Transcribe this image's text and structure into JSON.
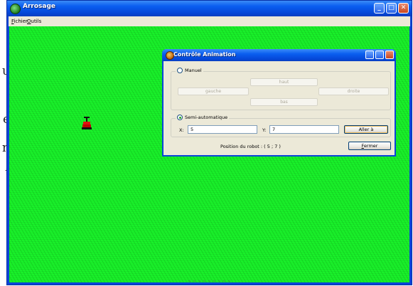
{
  "background_doc": {
    "chars": [
      "u",
      "e",
      "n",
      "t"
    ]
  },
  "main_window": {
    "title": "Arrosage",
    "menu": {
      "file": "Fichier",
      "file_mnemonic": "F",
      "file_rest": "ichier",
      "tools": "Outils",
      "tools_mnemonic": "O",
      "tools_rest": "utils"
    },
    "status_fragment": "~ ~ ~ ~ ~ ~ ~ ~ ~",
    "grass_color": "#19f02a"
  },
  "dialog": {
    "title": "Contrôle Animation",
    "manual": {
      "label": "Manuel",
      "selected": false,
      "buttons": {
        "up": "haut",
        "left": "gauche",
        "right": "droite",
        "down": "bas"
      }
    },
    "semi_auto": {
      "label": "Semi-automatique",
      "selected": true,
      "x_label": "X:",
      "x_value": "5",
      "y_label": "Y:",
      "y_value": "7",
      "goto_button": "Aller à"
    },
    "position_text": "Position du robot : ( 5 ; 7 )",
    "close_button": "Fermer",
    "close_mnemonic": "F",
    "close_rest": "ermer"
  },
  "icons": [
    "app-icon",
    "minimize-icon",
    "maximize-icon",
    "close-icon",
    "robot-icon",
    "dialog-app-icon"
  ]
}
